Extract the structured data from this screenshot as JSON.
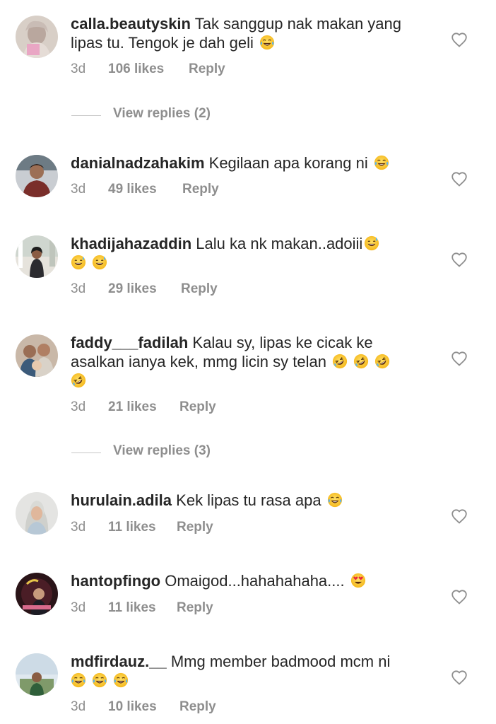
{
  "comments": [
    {
      "username": "calla.beautyskin",
      "text": "Tak sanggup nak makan yang lipas tu. Tengok je dah geli",
      "emoji_icons": [
        "face-with-tears-of-joy-icon"
      ],
      "time": "3d",
      "likes": "106 likes",
      "reply": "Reply"
    },
    {
      "username": "danialnadzahakim",
      "text": "Kegilaan apa korang ni",
      "emoji_icons": [
        "face-with-tears-of-joy-icon"
      ],
      "time": "3d",
      "likes": "49 likes",
      "reply": "Reply"
    },
    {
      "username": "khadijahazaddin",
      "text": "Lalu ka nk makan..adoiii",
      "emoji_icons": [
        "grinning-sweat-icon",
        "grinning-sweat-icon",
        "grinning-sweat-icon"
      ],
      "time": "3d",
      "likes": "29 likes",
      "reply": "Reply"
    },
    {
      "username": "faddy___fadilah",
      "text": "Kalau sy, lipas ke cicak ke asalkan ianya kek, mmg licin sy telan",
      "emoji_icons": [
        "rolling-on-floor-laughing-icon",
        "rolling-on-floor-laughing-icon",
        "rolling-on-floor-laughing-icon",
        "rolling-on-floor-laughing-icon"
      ],
      "time": "3d",
      "likes": "21 likes",
      "reply": "Reply"
    },
    {
      "username": "hurulain.adila",
      "text": "Kek lipas tu rasa apa",
      "emoji_icons": [
        "face-with-tears-of-joy-icon"
      ],
      "time": "3d",
      "likes": "11 likes",
      "reply": "Reply"
    },
    {
      "username": "hantopfingo",
      "text": "Omaigod...hahahahaha....",
      "emoji_icons": [
        "heart-eyes-icon"
      ],
      "time": "3d",
      "likes": "11 likes",
      "reply": "Reply"
    },
    {
      "username": "mdfirdauz.__",
      "text": "Mmg member badmood mcm ni",
      "emoji_icons": [
        "face-with-tears-of-joy-icon",
        "face-with-tears-of-joy-icon",
        "face-with-tears-of-joy-icon"
      ],
      "time": "3d",
      "likes": "10 likes",
      "reply": "Reply"
    }
  ],
  "view_replies": [
    {
      "label": "View replies (2)"
    },
    {
      "label": "View replies (3)"
    }
  ],
  "colors": {
    "text": "#262626",
    "secondary": "#8e8e8e",
    "divider": "#c7c7c7"
  }
}
